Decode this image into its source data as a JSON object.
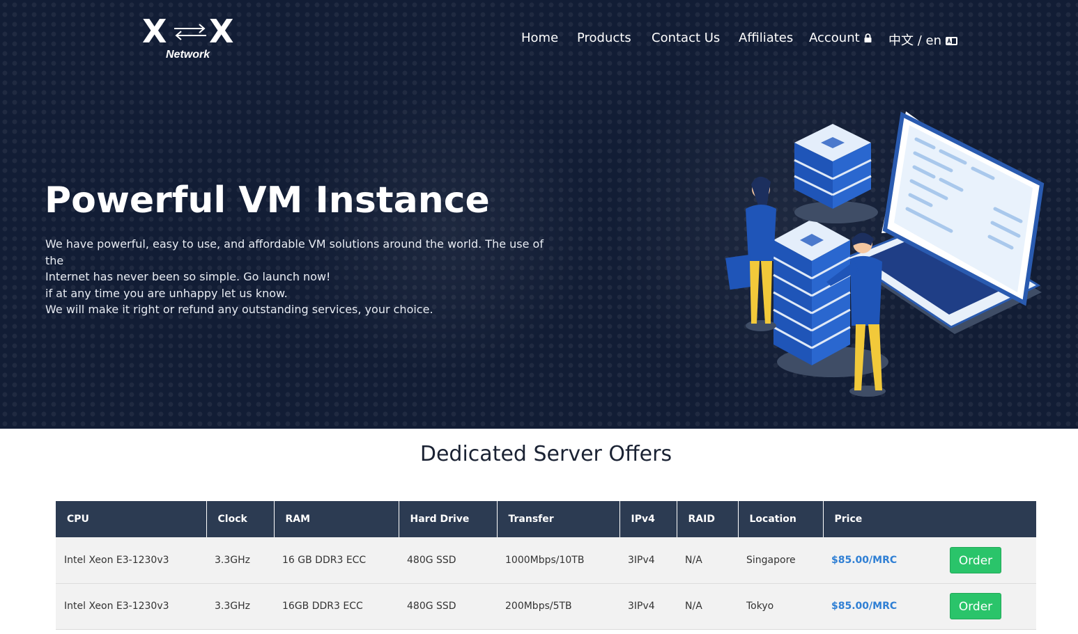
{
  "brand": {
    "logo_text": "XX",
    "sub_label": "Network"
  },
  "nav": {
    "items": [
      {
        "label": "Home"
      },
      {
        "label": "Products"
      },
      {
        "label": "Contact Us"
      },
      {
        "label": "Affiliates"
      },
      {
        "label": "Account"
      },
      {
        "label": "中文 / en"
      }
    ]
  },
  "hero": {
    "title": "Powerful VM Instance",
    "lines": [
      "We have powerful, easy to use, and affordable VM solutions around the world. The use of the",
      "Internet has never been so simple. Go launch now!",
      "if at any time you are unhappy let us know.",
      "We will make it right or refund any outstanding services, your choice."
    ]
  },
  "offers": {
    "title": "Dedicated Server Offers",
    "columns": [
      "CPU",
      "Clock",
      "RAM",
      "Hard Drive",
      "Transfer",
      "IPv4",
      "RAID",
      "Location",
      "Price",
      ""
    ],
    "rows": [
      {
        "cpu": "Intel Xeon E3-1230v3",
        "clock": "3.3GHz",
        "ram": "16 GB DDR3 ECC",
        "drive": "480G SSD",
        "transfer": "1000Mbps/10TB",
        "ipv4": "3IPv4",
        "raid": "N/A",
        "location": "Singapore",
        "price": "$85.00/MRC",
        "action": "Order"
      },
      {
        "cpu": "Intel Xeon E3-1230v3",
        "clock": "3.3GHz",
        "ram": "16GB DDR3 ECC",
        "drive": "480G SSD",
        "transfer": "200Mbps/5TB",
        "ipv4": "3IPv4",
        "raid": "N/A",
        "location": "Tokyo",
        "price": "$85.00/MRC",
        "action": "Order"
      }
    ]
  },
  "colors": {
    "hero_bg": "#121d35",
    "table_header": "#2c3b52",
    "price": "#2f7fd4",
    "order_button": "#2ac46a"
  },
  "icons": {
    "account": "lock-icon",
    "language": "language-icon"
  }
}
